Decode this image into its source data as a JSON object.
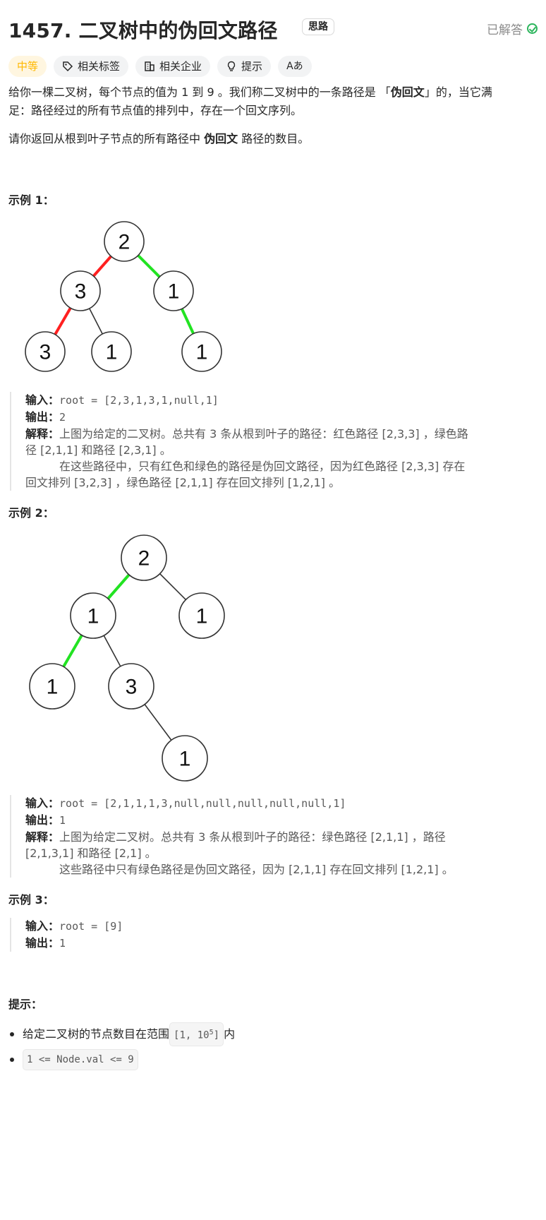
{
  "problem": {
    "title": "1457. 二叉树中的伪回文路径",
    "hint_badge": "思路",
    "solved_label": "已解答"
  },
  "tags": {
    "difficulty": "中等",
    "related_tags": "相关标签",
    "related_companies": "相关企业",
    "hints": "提示",
    "font_icon_label": "Aあ"
  },
  "description": {
    "p1_a": "给你一棵二叉树，每个节点的值为 1 到 9 。我们称二叉树中的一条路径是 「",
    "p1_bold": "伪回文",
    "p1_b": "」的，当它满",
    "p1_c": "足：路径经过的所有节点值的排列中，存在一个回文序列。",
    "p2_a": "请你返回从根到叶子节点的所有路径中 ",
    "p2_bold": "伪回文",
    "p2_b": " 路径的数目。"
  },
  "examples": {
    "ex1": {
      "heading": "示例 1：",
      "input_label": "输入：",
      "input": "root = [2,3,1,3,1,null,1]",
      "output_label": "输出：",
      "output": "2",
      "explain_label": "解释：",
      "explain_1": "上图为给定的二叉树。总共有 3 条从根到叶子的路径：红色路径 [2,3,3] ，绿色路",
      "explain_2": "径 [2,1,1] 和路径 [2,3,1] 。",
      "explain_3": "在这些路径中，只有红色和绿色的路径是伪回文路径，因为红色路径 [2,3,3] 存在",
      "explain_4": "回文排列 [3,2,3] ，绿色路径 [2,1,1] 存在回文排列 [1,2,1] 。",
      "tree_nodes": [
        "2",
        "3",
        "1",
        "3",
        "1",
        "1"
      ]
    },
    "ex2": {
      "heading": "示例 2：",
      "input_label": "输入：",
      "input": "root = [2,1,1,1,3,null,null,null,null,null,1]",
      "output_label": "输出：",
      "output": "1",
      "explain_label": "解释：",
      "explain_1": "上图为给定二叉树。总共有 3 条从根到叶子的路径：绿色路径 [2,1,1] ，路径",
      "explain_2": "[2,1,3,1] 和路径 [2,1] 。",
      "explain_3": "这些路径中只有绿色路径是伪回文路径，因为 [2,1,1] 存在回文排列 [1,2,1] 。",
      "tree_nodes": [
        "2",
        "1",
        "1",
        "1",
        "3",
        "1"
      ]
    },
    "ex3": {
      "heading": "示例 3：",
      "input_label": "输入：",
      "input": "root = [9]",
      "output_label": "输出：",
      "output": "1"
    }
  },
  "constraints": {
    "heading": "提示：",
    "c1_a": "给定二叉树的节点数目在范围 ",
    "c1_code": "[1, 10",
    "c1_sup": "5",
    "c1_code_end": "]",
    "c1_b": " 内",
    "c2_code": "1 <= Node.val <= 9"
  },
  "colors": {
    "red_path": "#ff2020",
    "green_path": "#22e322",
    "difficulty": "#ffb800",
    "solved": "#2db55d"
  }
}
